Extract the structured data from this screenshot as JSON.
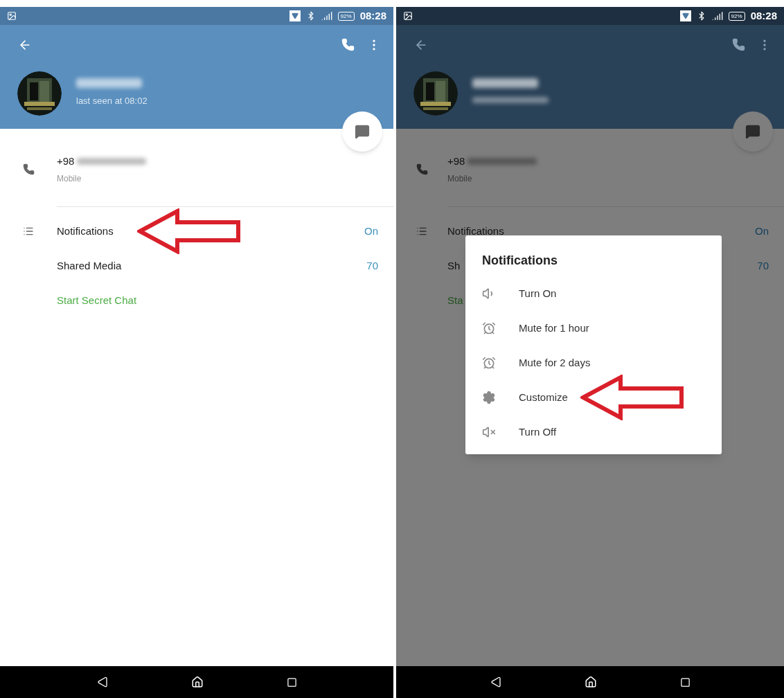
{
  "screens": [
    {
      "dimmed": false,
      "status_bar": {
        "battery": "92%",
        "time": "08:28"
      },
      "header": {
        "status": "last seen at 08:02"
      },
      "phone": {
        "prefix": "+98",
        "label": "Mobile"
      },
      "rows": [
        {
          "kind": "setting",
          "label": "Notifications",
          "value": "On",
          "arrow": true
        },
        {
          "kind": "setting",
          "label": "Shared Media",
          "value": "70",
          "arrow": false
        },
        {
          "kind": "action",
          "label": "Start Secret Chat",
          "arrow": false
        }
      ]
    },
    {
      "dimmed": true,
      "status_bar": {
        "battery": "92%",
        "time": "08:28"
      },
      "phone": {
        "prefix": "+98",
        "label": "Mobile"
      },
      "rows": [
        {
          "kind": "setting",
          "label": "Notifications",
          "value": "On",
          "arrow": false
        },
        {
          "kind": "setting",
          "label": "Sh",
          "value": "70",
          "arrow": false
        },
        {
          "kind": "action",
          "label": "Sta",
          "arrow": false
        }
      ],
      "dialog": {
        "title": "Notifications",
        "items": [
          {
            "kind": "sound",
            "label": "Turn On",
            "arrow": false
          },
          {
            "kind": "alarm",
            "label": "Mute for 1 hour",
            "arrow": false
          },
          {
            "kind": "alarm",
            "label": "Mute for 2 days",
            "arrow": false
          },
          {
            "kind": "settings",
            "label": "Customize",
            "arrow": true
          },
          {
            "kind": "mute",
            "label": "Turn Off",
            "arrow": false
          }
        ]
      }
    }
  ]
}
